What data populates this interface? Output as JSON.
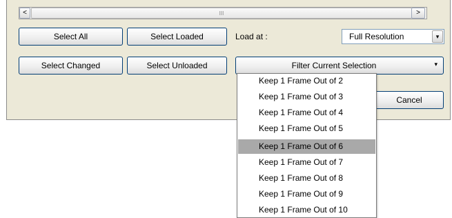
{
  "scrollbar": {
    "left_arrow": "<",
    "right_arrow": ">",
    "grip": "III"
  },
  "buttons": {
    "select_all": "Select All",
    "select_loaded": "Select Loaded",
    "select_changed": "Select Changed",
    "select_unloaded": "Select Unloaded",
    "cancel": "Cancel"
  },
  "load_at": {
    "label": "Load at :",
    "selected": "Full Resolution",
    "arrow": "▾"
  },
  "filter": {
    "selected": "Filter Current Selection",
    "arrow": "▾"
  },
  "dropdown": {
    "items": [
      "Keep 1 Frame Out of 2",
      "Keep 1 Frame Out of 3",
      "Keep 1 Frame Out of 4",
      "Keep 1 Frame Out of 5",
      "Keep 1 Frame Out of 6",
      "Keep 1 Frame Out of 7",
      "Keep 1 Frame Out of 8",
      "Keep 1 Frame Out of 9",
      "Keep 1 Frame Out of 10"
    ],
    "highlighted_index": 4
  },
  "colors": {
    "panel": "#ece9d8",
    "highlight": "#a9a9a9",
    "button_border": "#003c74"
  }
}
